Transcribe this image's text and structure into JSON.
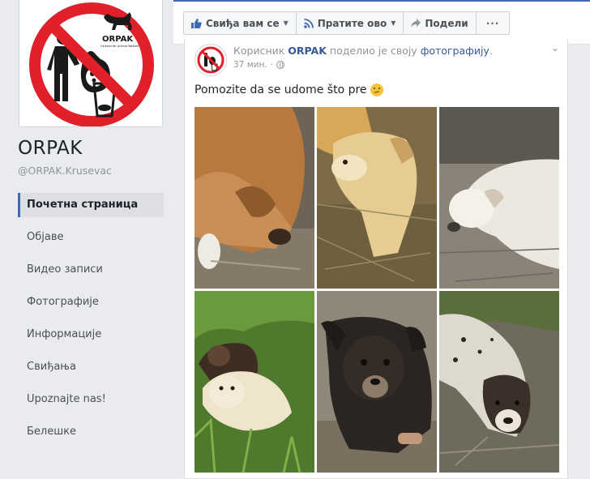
{
  "page": {
    "name": "ORPAK",
    "handle": "@ORPAK.Krusevac",
    "logo_text": "ORPAK",
    "logo_subtext": "Citizens for Animal Welfare"
  },
  "nav": {
    "items": [
      {
        "label": "Почетна страница",
        "active": true
      },
      {
        "label": "Објаве"
      },
      {
        "label": "Видео записи"
      },
      {
        "label": "Фотографије"
      },
      {
        "label": "Информације"
      },
      {
        "label": "Свиђања"
      },
      {
        "label": "Upoznajte nas!"
      },
      {
        "label": "Белешке"
      }
    ]
  },
  "actions": {
    "like": "Свиђа вам се",
    "follow": "Пратите ово",
    "share": "Подели",
    "more": "···"
  },
  "post": {
    "prefix": "Корисник",
    "actor": "ORPAK",
    "middle": "поделио је своју",
    "object": "фотографију",
    "suffix": ".",
    "time": "37 мин.",
    "separator": "·",
    "message": "Pomozite da se udome što pre",
    "chevron": "⌄"
  },
  "colors": {
    "accent": "#4267b2",
    "link": "#365899",
    "no_sign_red": "#e0202a"
  },
  "icons": [
    "thumbs-up-icon",
    "rss-icon",
    "share-arrow-icon",
    "globe-icon",
    "chevron-down-icon",
    "emoji-icon"
  ]
}
